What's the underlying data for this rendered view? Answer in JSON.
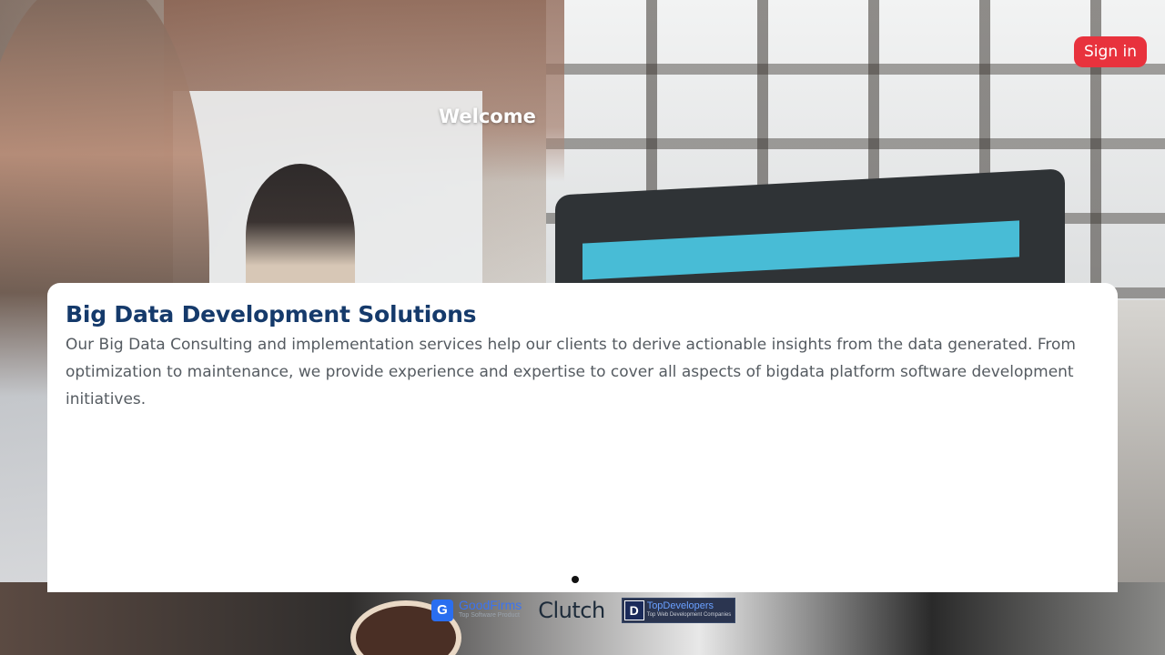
{
  "header": {
    "signin_label": "Sign in",
    "welcome_text": "Welcome"
  },
  "card": {
    "title": "Big Data Development Solutions",
    "description": "Our Big Data Consulting and implementation services help our clients to derive actionable insights from the data generated. From optimization to maintenance, we provide experience and expertise to cover all aspects of bigdata platform software development initiatives."
  },
  "carousel": {
    "active_index": 1,
    "total": 1
  },
  "badges": {
    "goodfirms": {
      "logo_letter": "G",
      "name": "GoodFirms",
      "subtitle": "Top Software Product"
    },
    "clutch": {
      "name": "Clutch"
    },
    "topdevelopers": {
      "logo_letter": "D",
      "name": "TopDevelopers",
      "subtitle": "Top Web Development Companies"
    }
  },
  "colors": {
    "signin_bg": "#e8323d",
    "title": "#153a6b",
    "body_text": "#555b61"
  }
}
